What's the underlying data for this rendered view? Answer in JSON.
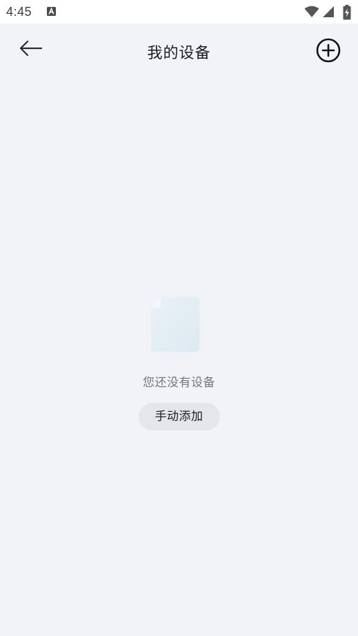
{
  "status_bar": {
    "time": "4:45",
    "icons": [
      "a-icon",
      "wifi-icon",
      "signal-icon",
      "battery-icon"
    ]
  },
  "header": {
    "title": "我的设备",
    "back_icon": "arrow-left-icon",
    "add_icon": "plus-circle-icon"
  },
  "empty_state": {
    "message": "您还没有设备",
    "button_label": "手动添加",
    "illustration_icon": "empty-document-icon"
  },
  "colors": {
    "background": "#f2f3f7",
    "status_bar_bg": "#ffffff",
    "title_text": "#1d1d1f",
    "muted_text": "#73767d",
    "button_bg": "#e5e6ea"
  }
}
